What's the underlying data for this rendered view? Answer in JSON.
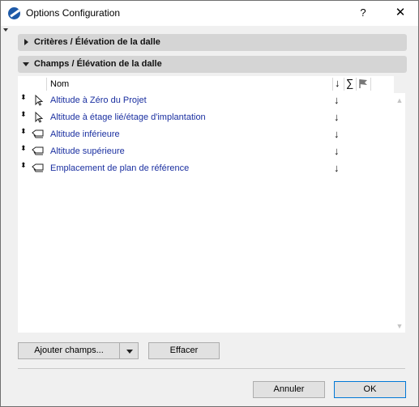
{
  "window": {
    "title": "Options Configuration",
    "help_label": "?",
    "close_label": "✕"
  },
  "sections": {
    "criteria": {
      "label": "Critères /  Élévation de la dalle",
      "state": "collapsed"
    },
    "fields": {
      "label": "Champs /  Élévation de la dalle",
      "state": "expanded"
    }
  },
  "list": {
    "header": {
      "name": "Nom",
      "sort_symbol": "↓",
      "sum_symbol": "∑",
      "flag_icon": "flag-icon"
    },
    "rows": [
      {
        "label": "Altitude à Zéro du Projet",
        "icon": "pointer-icon",
        "sort": "↓"
      },
      {
        "label": "Altitude à étage lié/étage d'implantation",
        "icon": "pointer-icon",
        "sort": "↓"
      },
      {
        "label": "Altitude inférieure",
        "icon": "slab-tag-icon",
        "sort": "↓"
      },
      {
        "label": "Altitude supérieure",
        "icon": "slab-tag-icon",
        "sort": "↓"
      },
      {
        "label": "Emplacement de plan de référence",
        "icon": "slab-tag-icon",
        "sort": "↓"
      }
    ],
    "drag_handle": "⬍"
  },
  "scrollbar": {
    "up": "▲",
    "down": "▼"
  },
  "buttons": {
    "add_fields": "Ajouter champs...",
    "clear": "Effacer",
    "cancel": "Annuler",
    "ok": "OK"
  },
  "colors": {
    "field_text": "#1a2fa0",
    "section_bar": "#d5d5d5",
    "ok_border": "#0078d7"
  }
}
